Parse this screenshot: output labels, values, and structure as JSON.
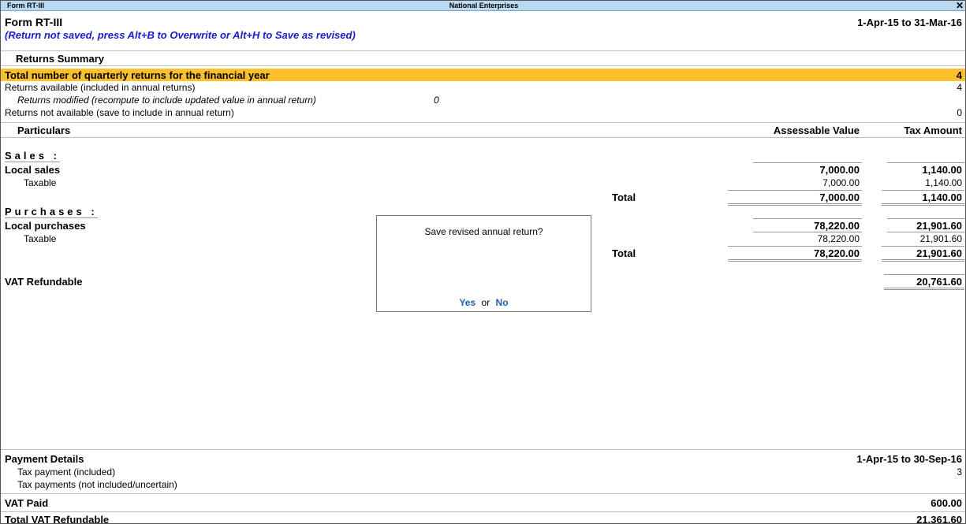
{
  "window": {
    "left_title": "Form RT-III",
    "center_title": "National Enterprises",
    "close_glyph": "✕"
  },
  "header": {
    "form_title": "Form RT-III",
    "period": "1-Apr-15 to 31-Mar-16",
    "notice": "(Return not saved, press Alt+B to Overwrite or Alt+H to Save as revised)"
  },
  "returns_summary": {
    "title": "Returns Summary",
    "rows": [
      {
        "label": "Total number of quarterly returns for the financial year",
        "value": "4"
      },
      {
        "label": "Returns available (included in annual returns)",
        "value": "4"
      },
      {
        "label": "Returns modified (recompute to include updated value in annual return)",
        "value": "0"
      },
      {
        "label": "Returns not available (save to include in annual return)",
        "value": "0"
      }
    ]
  },
  "columns": {
    "particulars": "Particulars",
    "assessable_value": "Assessable Value",
    "tax_amount": "Tax Amount"
  },
  "sales": {
    "title": "Sales :",
    "group_label": "Local sales",
    "group_assessable": "7,000.00",
    "group_tax": "1,140.00",
    "sub_label": "Taxable",
    "sub_assessable": "7,000.00",
    "sub_tax": "1,140.00",
    "total_label": "Total",
    "total_assessable": "7,000.00",
    "total_tax": "1,140.00"
  },
  "purchases": {
    "title": "Purchases :",
    "group_label": "Local purchases",
    "group_assessable": "78,220.00",
    "group_tax": "21,901.60",
    "sub_label": "Taxable",
    "sub_assessable": "78,220.00",
    "sub_tax": "21,901.60",
    "total_label": "Total",
    "total_assessable": "78,220.00",
    "total_tax": "21,901.60"
  },
  "vat_refundable": {
    "label": "VAT Refundable",
    "value": "20,761.60"
  },
  "dialog": {
    "question": "Save revised annual return?",
    "yes": "Yes",
    "or": "or",
    "no": "No"
  },
  "payment": {
    "title": "Payment Details",
    "period": "1-Apr-15 to 30-Sep-16",
    "included_label": "Tax payment (included)",
    "included_value": "3",
    "not_included_label": "Tax payments (not included/uncertain)"
  },
  "vat_paid": {
    "label": "VAT Paid",
    "value": "600.00"
  },
  "total_vat_refundable": {
    "label": "Total VAT Refundable",
    "value": "21,361.60"
  }
}
